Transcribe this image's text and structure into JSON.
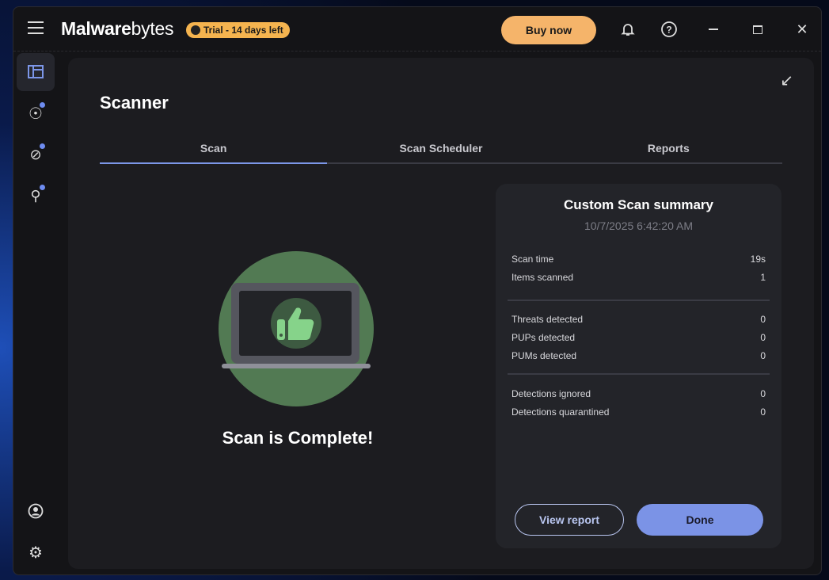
{
  "header": {
    "logo_bold": "Malware",
    "logo_light": "bytes",
    "trial_badge": "Trial - 14 days left",
    "buy_now": "Buy now"
  },
  "page": {
    "title": "Scanner",
    "tabs": [
      {
        "label": "Scan"
      },
      {
        "label": "Scan Scheduler"
      },
      {
        "label": "Reports"
      }
    ]
  },
  "status": {
    "message": "Scan is Complete!"
  },
  "summary": {
    "title": "Custom Scan summary",
    "date": "10/7/2025 6:42:20 AM",
    "groups": [
      [
        {
          "label": "Scan time",
          "value": "19s"
        },
        {
          "label": "Items scanned",
          "value": "1"
        }
      ],
      [
        {
          "label": "Threats detected",
          "value": "0"
        },
        {
          "label": "PUPs detected",
          "value": "0"
        },
        {
          "label": "PUMs detected",
          "value": "0"
        }
      ],
      [
        {
          "label": "Detections ignored",
          "value": "0"
        },
        {
          "label": "Detections quarantined",
          "value": "0"
        }
      ]
    ],
    "view_report": "View report",
    "done": "Done"
  },
  "colors": {
    "accent": "#7b93e6",
    "trial": "#f5b44f",
    "illustration": "#527a53"
  }
}
